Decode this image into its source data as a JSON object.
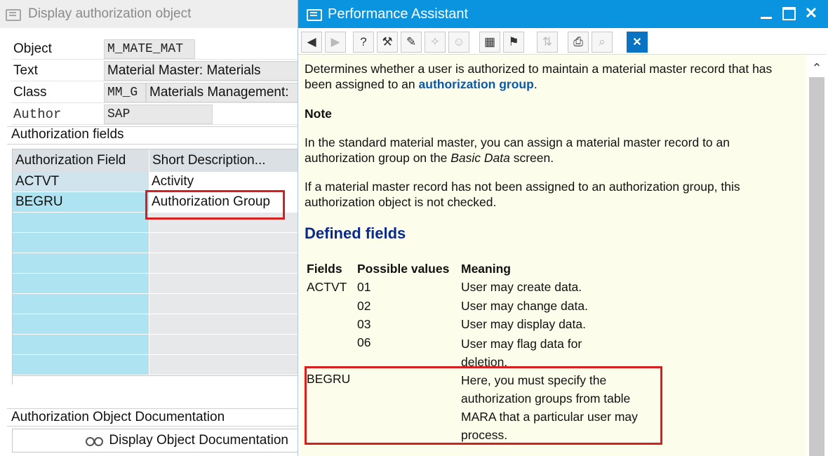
{
  "back": {
    "title": "Display authorization object",
    "fields": {
      "object": {
        "label": "Object",
        "value": "M_MATE_MAT"
      },
      "text": {
        "label": "Text",
        "value": "Material Master: Materials"
      },
      "class": {
        "label": "Class",
        "code": "MM_G",
        "value": "Materials Management:"
      },
      "author": {
        "label": "Author",
        "value": "SAP"
      }
    },
    "auth_fields_label": "Authorization fields",
    "grid": {
      "headers": [
        "Authorization Field",
        "Short Description..."
      ],
      "rows": [
        {
          "field": "ACTVT",
          "desc": "Activity"
        },
        {
          "field": "BEGRU",
          "desc": "Authorization Group"
        }
      ]
    },
    "doc_section_label": "Authorization Object Documentation",
    "doc_button_label": "Display Object Documentation"
  },
  "pa": {
    "title": "Performance Assistant",
    "intro_pre": "Determines whether a user is authorized to maintain a material master record that has been assigned to an",
    "intro_link": "authorization group",
    "intro_post": ".",
    "note_heading": "Note",
    "note_pre": "In the standard material master, you can assign a material master record to an authorization group on the",
    "note_italic": "Basic Data",
    "note_post": "screen.",
    "para3": "If a material master record has not been assigned to an authorization group, this authorization object is not checked.",
    "defined_heading": "Defined fields",
    "table": {
      "headers": [
        "Fields",
        "Possible values",
        "Meaning"
      ],
      "actvt": {
        "field": "ACTVT",
        "values": [
          {
            "value": "01",
            "meaning": "User may create data."
          },
          {
            "value": "02",
            "meaning": "User may change data."
          },
          {
            "value": "03",
            "meaning": "User may display data."
          },
          {
            "value": "06",
            "meaning": "User may flag data for deletion."
          }
        ]
      },
      "begru": {
        "field": "BEGRU",
        "meaning": "Here, you must specify the authorization groups from table MARA that a particular user may process."
      }
    }
  },
  "colors": {
    "title_blue": "#0a94e0",
    "highlight_red": "#d62020",
    "help_bg": "#fdfdeb",
    "grid_cyan": "#aee4f2"
  }
}
